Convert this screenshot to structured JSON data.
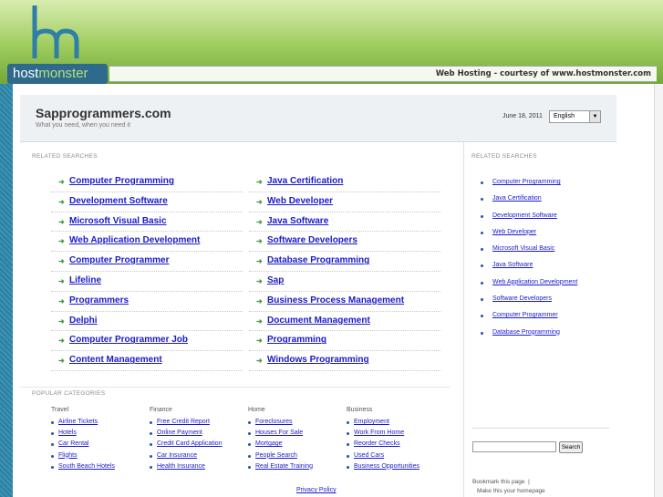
{
  "header": {
    "logo_host": "host",
    "logo_monster": "monster",
    "banner": "Web Hosting - courtesy of www.hostmonster.com"
  },
  "site": {
    "title": "Sapprogrammers.com",
    "subtitle": "What you need, when you need it",
    "date": "June 18, 2011",
    "language": "English"
  },
  "related_left_label": "RELATED SEARCHES",
  "related_left": {
    "col1": [
      "Computer Programming",
      "Development Software",
      "Microsoft Visual Basic",
      "Web Application Development",
      "Computer Programmer",
      "Lifeline",
      "Programmers",
      "Delphi",
      "Computer Programmer Job",
      "Content Management"
    ],
    "col2": [
      "Java Certification",
      "Web Developer",
      "Java Software",
      "Software Developers",
      "Database Programming",
      "Sap",
      "Business Process Management",
      "Document Management",
      "Programming",
      "Windows Programming"
    ]
  },
  "related_right_label": "RELATED SEARCHES",
  "related_right": [
    "Computer Programming",
    "Java Certification",
    "Development Software",
    "Web Developer",
    "Microsoft Visual Basic",
    "Java Software",
    "Web Application Development",
    "Software Developers",
    "Computer Programmer",
    "Database Programming"
  ],
  "popular_label": "POPULAR CATEGORIES",
  "popular": [
    {
      "heading": "Travel",
      "items": [
        "Airline Tickets",
        "Hotels",
        "Car Rental",
        "Flights",
        "South Beach Hotels"
      ]
    },
    {
      "heading": "Finance",
      "items": [
        "Free Credit Report",
        "Online Payment",
        "Credit Card Application",
        "Car Insurance",
        "Health Insurance"
      ]
    },
    {
      "heading": "Home",
      "items": [
        "Foreclosures",
        "Houses For Sale",
        "Mortgage",
        "People Search",
        "Real Estate Training"
      ]
    },
    {
      "heading": "Business",
      "items": [
        "Employment",
        "Work From Home",
        "Reorder Checks",
        "Used Cars",
        "Business Opportunities"
      ]
    }
  ],
  "search": {
    "button": "Search",
    "value": ""
  },
  "bookmark": "Bookmark this page",
  "homepage": "Make this your homepage",
  "privacy": "Privacy Policy"
}
